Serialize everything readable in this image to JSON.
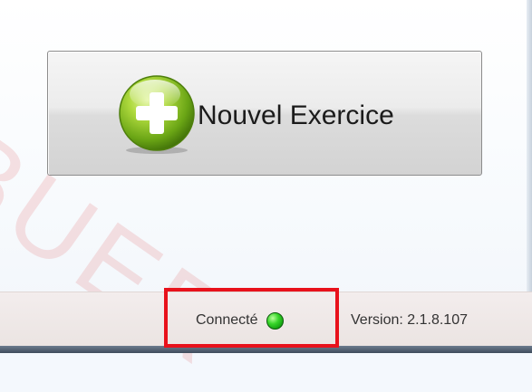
{
  "watermark": {
    "text": "BUER"
  },
  "main": {
    "new_exercise_button": {
      "label": "Nouvel Exercice",
      "icon": "plus-circle-icon",
      "icon_color": "#8cc63f"
    }
  },
  "status_bar": {
    "connection_label": "Connecté",
    "connection_indicator": {
      "icon": "green-dot-icon",
      "color": "#2ecc1f",
      "state": "connected"
    },
    "version_text": "Version: 2.1.8.107"
  },
  "annotation": {
    "highlight_color": "#e8111b"
  }
}
